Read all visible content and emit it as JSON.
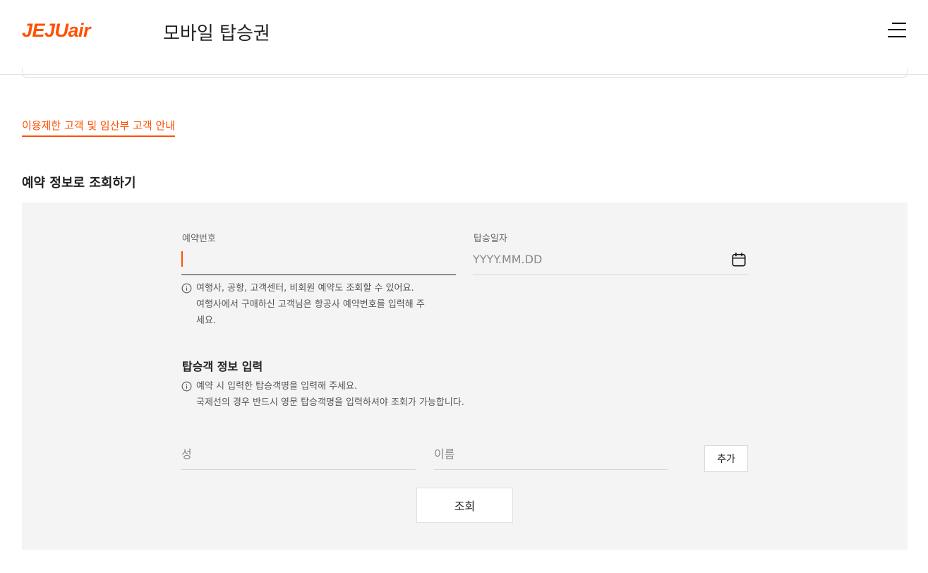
{
  "header": {
    "logo_text": "JEJUair",
    "title": "모바일 탑승권",
    "menu_icon": "hamburger-menu-icon",
    "brand_color": "#ff5000"
  },
  "notice_link": "이용제한 고객 및 임산부 고객 안내",
  "section_title": "예약 정보로 조회하기",
  "form": {
    "reservation_number": {
      "label": "예약번호",
      "value": "",
      "help_line1": "여행사, 공항, 고객센터, 비회원 예약도 조회할 수 있어요.",
      "help_line2": "여행사에서 구매하신 고객님은 항공사 예약번호를 입력해 주",
      "help_line3": "세요."
    },
    "boarding_date": {
      "label": "탑승일자",
      "placeholder": "YYYY.MM.DD",
      "icon": "calendar-icon"
    },
    "passenger": {
      "title": "탑승객 정보 입력",
      "help_line1": "예약 시 입력한 탑승객명을 입력해 주세요.",
      "help_line2": "국제선의 경우 반드시 영문 탑승객명을 입력하셔야 조회가 가능합니다.",
      "last_name_placeholder": "성",
      "first_name_placeholder": "이름",
      "add_label": "추가"
    },
    "search_label": "조회"
  }
}
